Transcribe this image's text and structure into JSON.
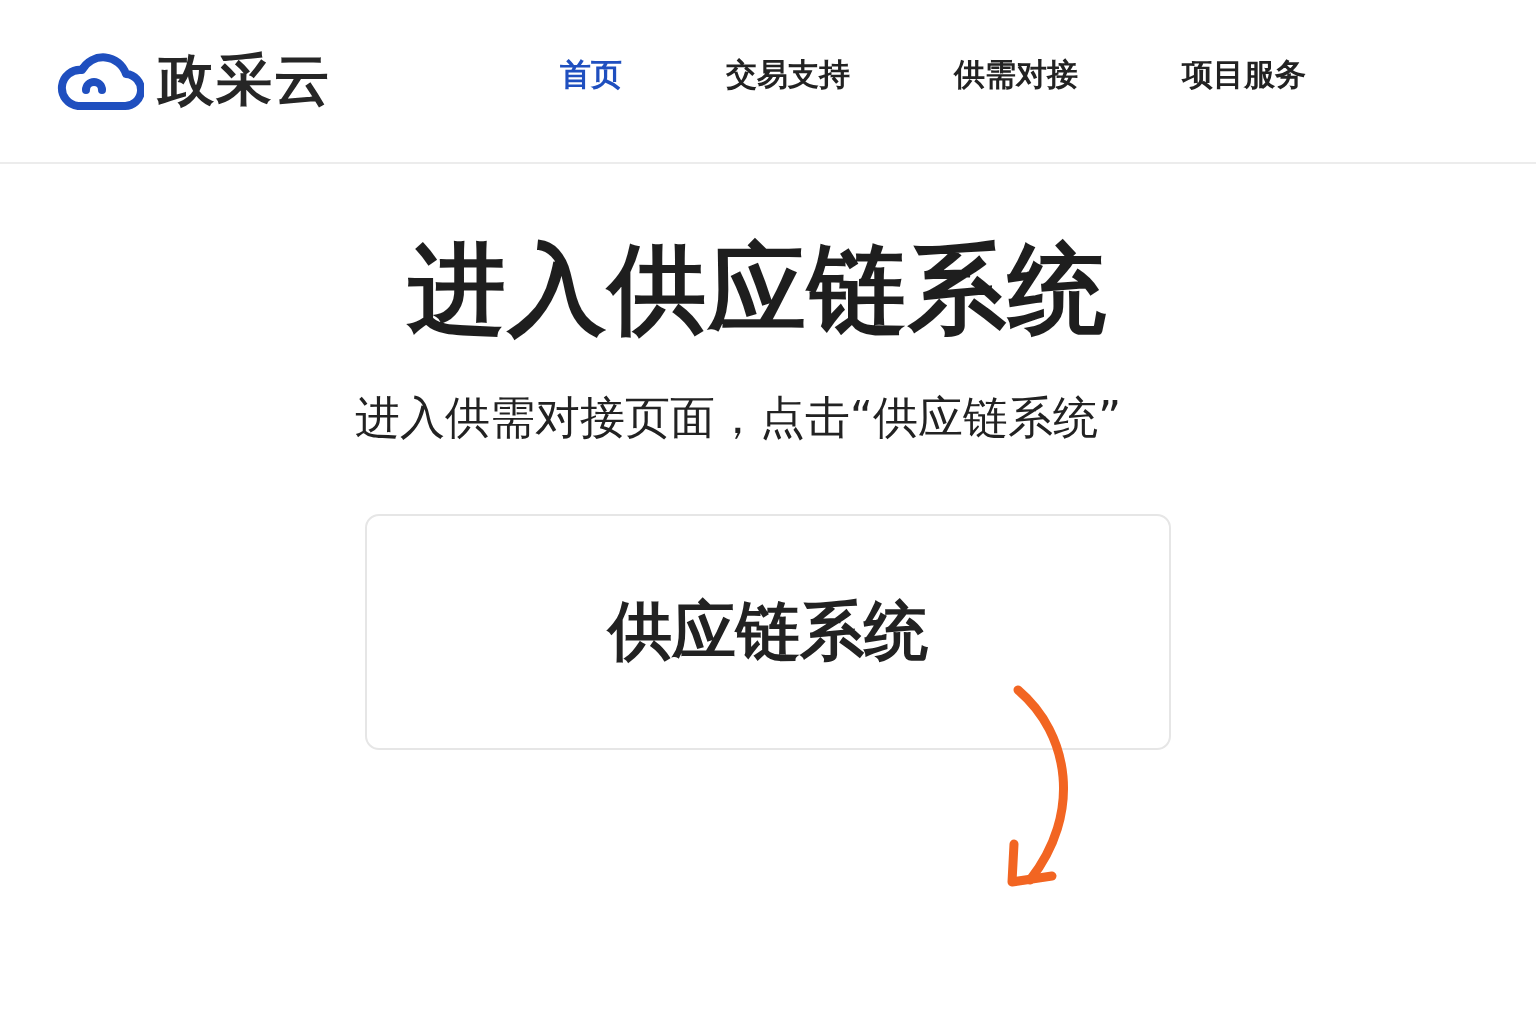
{
  "header": {
    "logo_text": "政采云",
    "nav": [
      {
        "label": "首页",
        "selected": true
      },
      {
        "label": "交易支持",
        "selected": false
      },
      {
        "label": "供需对接",
        "selected": false
      },
      {
        "label": "项目服务",
        "selected": false
      }
    ]
  },
  "main": {
    "title": "进入供应链系统",
    "instruction": "进入供需对接页面，点击“供应链系统”",
    "card": {
      "label": "供应链系统"
    }
  }
}
